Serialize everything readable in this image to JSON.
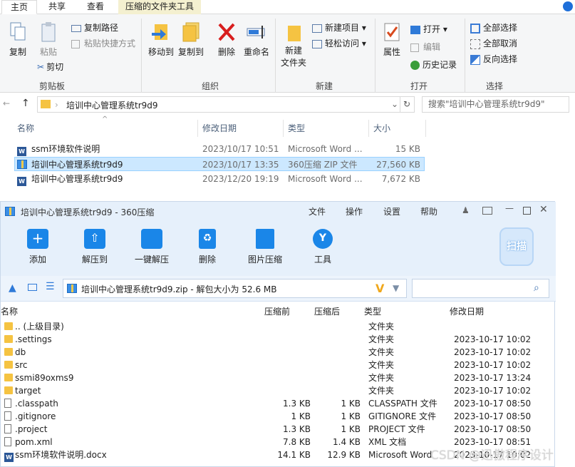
{
  "ribbon": {
    "tabs": [
      {
        "label": "主页",
        "active": true
      },
      {
        "label": "共享"
      },
      {
        "label": "查看"
      },
      {
        "label": "压缩的文件夹工具"
      }
    ],
    "clipboard": {
      "copy": "复制",
      "paste": "粘贴",
      "copy_path": "复制路径",
      "paste_shortcut": "粘贴快捷方式",
      "cut": "剪切",
      "label": "剪贴板"
    },
    "organize": {
      "move_to": "移动到",
      "copy_to": "复制到",
      "delete": "删除",
      "rename": "重命名",
      "label": "组织"
    },
    "new": {
      "new_folder_1": "新建",
      "new_folder_2": "文件夹",
      "new_item": "新建项目",
      "easy_access": "轻松访问",
      "label": "新建"
    },
    "open": {
      "properties": "属性",
      "open": "打开",
      "edit": "编辑",
      "history": "历史记录",
      "label": "打开"
    },
    "select": {
      "select_all": "全部选择",
      "select_none": "全部取消",
      "invert": "反向选择",
      "label": "选择"
    }
  },
  "address": {
    "path": "培训中心管理系统tr9d9",
    "search_placeholder": "搜索\"培训中心管理系统tr9d9\""
  },
  "explorer": {
    "columns": [
      "名称",
      "修改日期",
      "类型",
      "大小"
    ],
    "rows": [
      {
        "name": "ssm环境软件说明",
        "date": "2023/10/17 10:51",
        "type": "Microsoft Word ...",
        "size": "15 KB",
        "icon": "word"
      },
      {
        "name": "培训中心管理系统tr9d9",
        "date": "2023/10/17 13:35",
        "type": "360压缩 ZIP 文件",
        "size": "27,560 KB",
        "icon": "zip",
        "selected": true
      },
      {
        "name": "培训中心管理系统tr9d9",
        "date": "2023/12/20 19:19",
        "type": "Microsoft Word ...",
        "size": "7,672 KB",
        "icon": "word"
      }
    ]
  },
  "zip_window": {
    "title": "培训中心管理系统tr9d9 - 360压缩",
    "menu": [
      "文件",
      "操作",
      "设置",
      "帮助"
    ],
    "toolbar": [
      "添加",
      "解压到",
      "一键解压",
      "删除",
      "图片压缩",
      "工具"
    ],
    "scan_label": "扫描",
    "path": "培训中心管理系统tr9d9.zip - 解包大小为 52.6 MB",
    "columns": [
      "名称",
      "压缩前",
      "压缩后",
      "类型",
      "修改日期"
    ],
    "rows": [
      {
        "name": ".. (上级目录)",
        "before": "",
        "after": "",
        "type": "文件夹",
        "date": "",
        "icon": "folder"
      },
      {
        "name": ".settings",
        "before": "",
        "after": "",
        "type": "文件夹",
        "date": "2023-10-17 10:02",
        "icon": "folder"
      },
      {
        "name": "db",
        "before": "",
        "after": "",
        "type": "文件夹",
        "date": "2023-10-17 10:02",
        "icon": "folder"
      },
      {
        "name": "src",
        "before": "",
        "after": "",
        "type": "文件夹",
        "date": "2023-10-17 10:02",
        "icon": "folder"
      },
      {
        "name": "ssmi89oxms9",
        "before": "",
        "after": "",
        "type": "文件夹",
        "date": "2023-10-17 13:24",
        "icon": "folder"
      },
      {
        "name": "target",
        "before": "",
        "after": "",
        "type": "文件夹",
        "date": "2023-10-17 10:02",
        "icon": "folder"
      },
      {
        "name": ".classpath",
        "before": "1.3 KB",
        "after": "1 KB",
        "type": "CLASSPATH 文件",
        "date": "2023-10-17 08:50",
        "icon": "doc"
      },
      {
        "name": ".gitignore",
        "before": "1 KB",
        "after": "1 KB",
        "type": "GITIGNORE 文件",
        "date": "2023-10-17 08:50",
        "icon": "doc"
      },
      {
        "name": ".project",
        "before": "1.3 KB",
        "after": "1 KB",
        "type": "PROJECT 文件",
        "date": "2023-10-17 08:50",
        "icon": "doc"
      },
      {
        "name": "pom.xml",
        "before": "7.8 KB",
        "after": "1.4 KB",
        "type": "XML 文档",
        "date": "2023-10-17 08:51",
        "icon": "doc"
      },
      {
        "name": "ssm环境软件说明.docx",
        "before": "14.1 KB",
        "after": "12.9 KB",
        "type": "Microsoft Word",
        "date": "2023-10-17 10:02",
        "icon": "word"
      }
    ]
  },
  "watermark": "CSDN @迅傲程序设计"
}
